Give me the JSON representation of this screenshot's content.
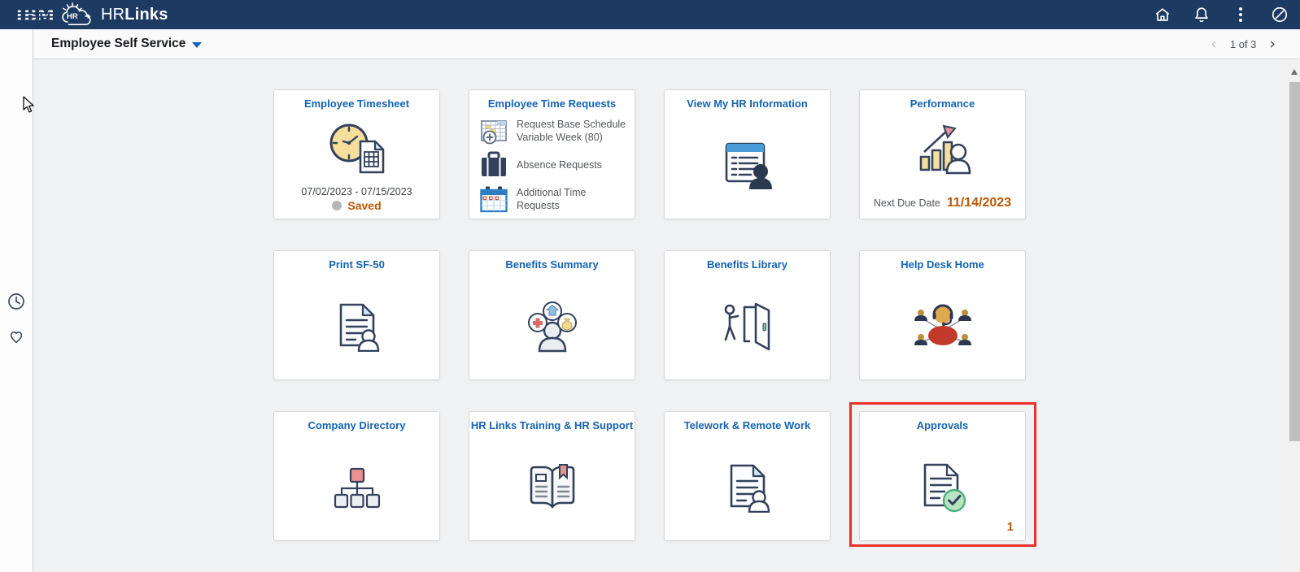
{
  "colors": {
    "topbar_navy": "#1d3a63",
    "tile_title_blue": "#1464b3",
    "status_orange": "#c05702",
    "highlight_red": "#e8312a",
    "icon_navy": "#33415c"
  },
  "topbar": {
    "ibm_logo_text": "IBM",
    "cloud_logo_text": "HR",
    "product_regular": "HR",
    "product_bold": "Links",
    "icons": {
      "home": "home-icon",
      "notifications": "bell-icon",
      "actions": "kebab-menu-icon",
      "navbar": "navbar-compass-icon"
    }
  },
  "header": {
    "title": "Employee Self Service",
    "pagination": "1 of 3",
    "prev_glyph": "‹",
    "next_glyph": "›"
  },
  "sidebar": {
    "icons": {
      "recent": "clock-icon",
      "favorites": "heart-icon"
    }
  },
  "tiles": [
    {
      "title": "Employee Timesheet",
      "date_range": "07/02/2023 - 07/15/2023",
      "status": "Saved"
    },
    {
      "title": "Employee Time Requests",
      "links": [
        {
          "label": "Request Base Schedule",
          "sublabel": "Variable Week (80)"
        },
        {
          "label": "Absence Requests"
        },
        {
          "label": "Additional Time Requests"
        }
      ]
    },
    {
      "title": "View My HR Information"
    },
    {
      "title": "Performance",
      "due_label": "Next Due Date",
      "due_date": "11/14/2023"
    },
    {
      "title": "Print SF-50"
    },
    {
      "title": "Benefits Summary"
    },
    {
      "title": "Benefits Library"
    },
    {
      "title": "Help Desk Home"
    },
    {
      "title": "Company Directory"
    },
    {
      "title": "HR Links Training & HR Support"
    },
    {
      "title": "Telework & Remote Work"
    },
    {
      "title": "Approvals",
      "badge_count": "1",
      "highlighted": true
    }
  ]
}
